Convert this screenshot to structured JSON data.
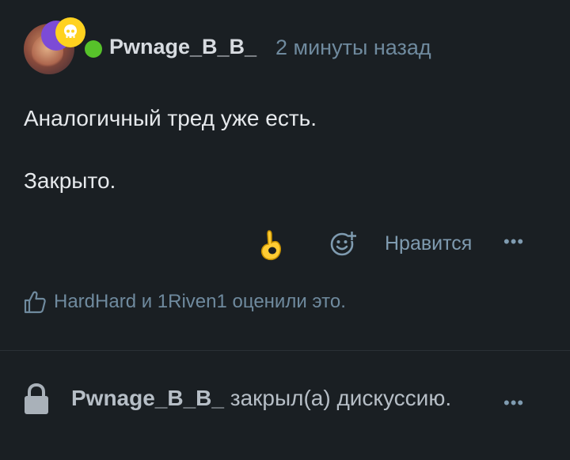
{
  "post": {
    "author": "Pwnage_B_B_",
    "timestamp": "2 минуты назад",
    "body_lines": [
      "Аналогичный тред уже есть.",
      "Закрыто."
    ],
    "reaction_emoji": "👌",
    "react_icon": "smiley-plus-icon",
    "like_label": "Нравится",
    "more_label": "•••",
    "likes_text": "HardHard и 1Riven1 оценили это."
  },
  "event": {
    "icon": "lock-icon",
    "user": "Pwnage_B_B_",
    "action": "закрыл(а) дискуссию.",
    "more_label": "•••"
  },
  "colors": {
    "background": "#1a1f23",
    "online": "#57c22a",
    "muted": "#6f8a9e",
    "badge_purple": "#7c4bd6",
    "badge_yellow": "#ffd21f"
  }
}
